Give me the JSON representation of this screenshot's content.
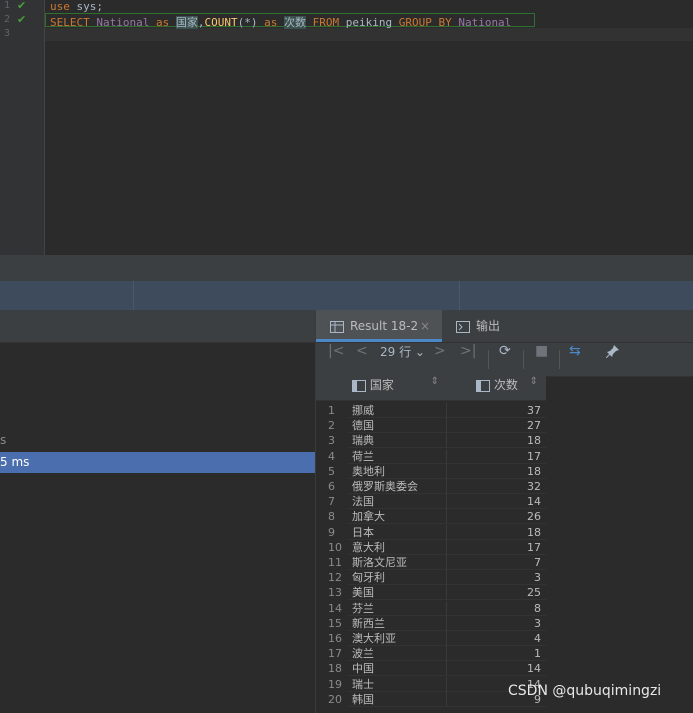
{
  "editor": {
    "line_numbers": [
      "1",
      "2",
      "3"
    ],
    "line1": {
      "kw": "use",
      "rest": " sys;"
    },
    "line2": {
      "t1": "SELECT",
      "t2": " National",
      "t3": " as ",
      "t4": "国家",
      "t5": ",",
      "t6": "COUNT",
      "t7": "(*)",
      "t8": " as ",
      "t9": "次数",
      "t10": " FROM",
      "t11": " peiking ",
      "t12": "GROUP BY",
      "t13": " National"
    }
  },
  "left_panel": {
    "line_a": "s",
    "selected_text": "5 ms"
  },
  "result": {
    "tabs": [
      {
        "label": "Result 18-2",
        "close": "×"
      },
      {
        "label": "输出"
      }
    ],
    "row_count": "29 行",
    "columns": [
      "国家",
      "次数"
    ],
    "rows": [
      {
        "n": "1",
        "country": "挪威",
        "count": "37"
      },
      {
        "n": "2",
        "country": "德国",
        "count": "27"
      },
      {
        "n": "3",
        "country": "瑞典",
        "count": "18"
      },
      {
        "n": "4",
        "country": "荷兰",
        "count": "17"
      },
      {
        "n": "5",
        "country": "奥地利",
        "count": "18"
      },
      {
        "n": "6",
        "country": "俄罗斯奥委会",
        "count": "32"
      },
      {
        "n": "7",
        "country": "法国",
        "count": "14"
      },
      {
        "n": "8",
        "country": "加拿大",
        "count": "26"
      },
      {
        "n": "9",
        "country": "日本",
        "count": "18"
      },
      {
        "n": "10",
        "country": "意大利",
        "count": "17"
      },
      {
        "n": "11",
        "country": "斯洛文尼亚",
        "count": "7"
      },
      {
        "n": "12",
        "country": "匈牙利",
        "count": "3"
      },
      {
        "n": "13",
        "country": "美国",
        "count": "25"
      },
      {
        "n": "14",
        "country": "芬兰",
        "count": "8"
      },
      {
        "n": "15",
        "country": "新西兰",
        "count": "3"
      },
      {
        "n": "16",
        "country": "澳大利亚",
        "count": "4"
      },
      {
        "n": "17",
        "country": "波兰",
        "count": "1"
      },
      {
        "n": "18",
        "country": "中国",
        "count": "14"
      },
      {
        "n": "19",
        "country": "瑞士",
        "count": "14"
      },
      {
        "n": "20",
        "country": "韩国",
        "count": "9"
      }
    ]
  },
  "watermark": "CSDN @qubuqimingzi",
  "colors": {
    "accent": "#4a88c7",
    "selection": "#4b6eaf",
    "keyword": "#cc7832",
    "identifier": "#9876aa",
    "function": "#ffc66d",
    "check": "#4a9c3a"
  }
}
